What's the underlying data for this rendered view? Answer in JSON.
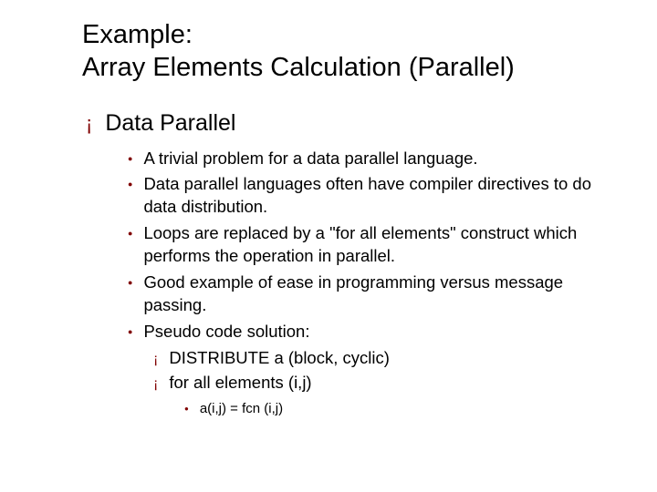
{
  "title_line1": "Example:",
  "title_line2": "Array Elements Calculation (Parallel)",
  "heading": "Data Parallel",
  "bullets": [
    "A trivial problem for a data parallel language.",
    "Data parallel languages often have compiler directives to do data distribution.",
    "Loops are replaced by a \"for all elements\" construct which performs the operation in parallel.",
    "Good example of ease in programming versus message passing.",
    "Pseudo code solution:"
  ],
  "sub_bullets": [
    "DISTRIBUTE a  (block, cyclic)",
    "for all elements (i,j)"
  ],
  "subsub": "a(i,j) = fcn (i,j)"
}
